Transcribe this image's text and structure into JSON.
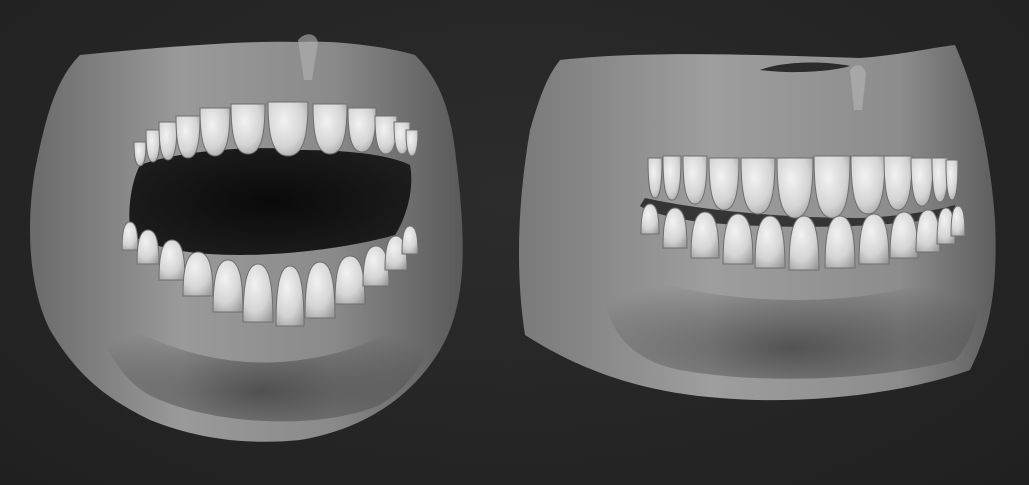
{
  "scene": {
    "background_color": "#262626",
    "models": [
      {
        "name": "open-mouth-teeth-model",
        "state": "open"
      },
      {
        "name": "closed-mouth-teeth-model",
        "state": "closed"
      }
    ],
    "render_style": "grey clay sculpt",
    "gum_color": "#8e8e8e",
    "tooth_color": "#dcdcdc",
    "cavity_color": "#141414"
  }
}
